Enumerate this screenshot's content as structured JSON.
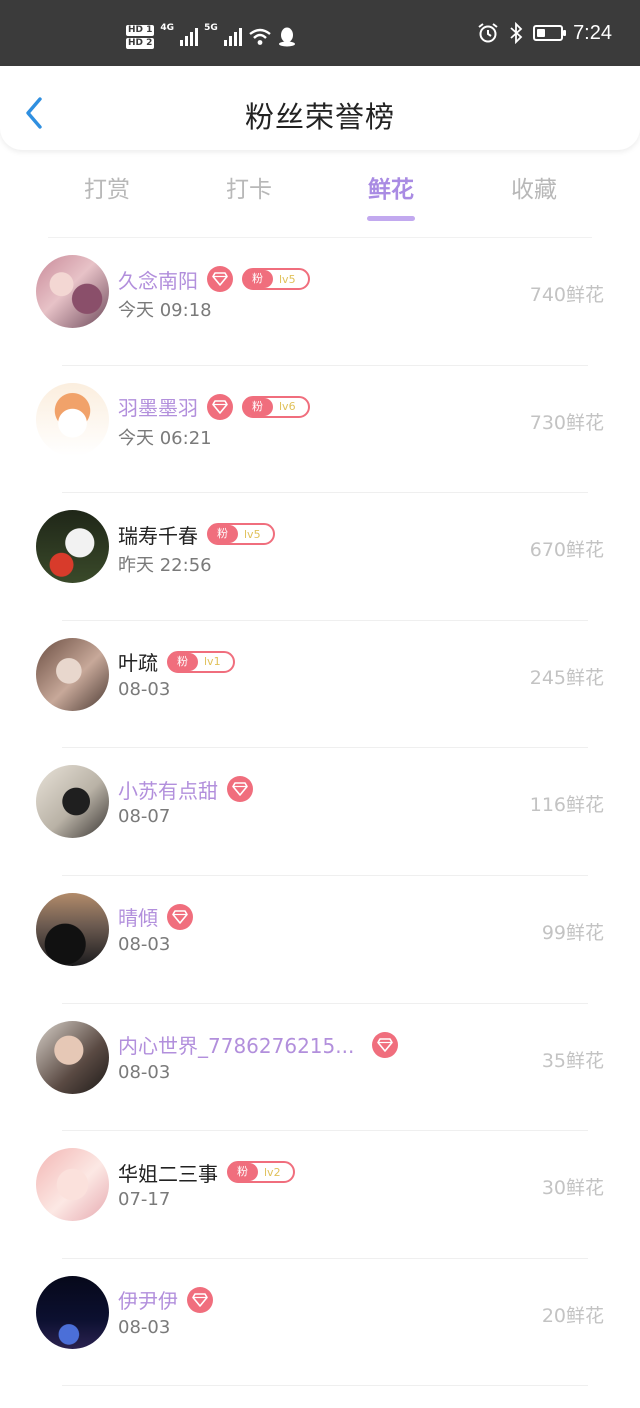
{
  "status_bar": {
    "hd1": "HD 1",
    "hd2": "HD 2",
    "net1": "4G",
    "net2": "5G",
    "time": "7:24",
    "battery_level": 0.35
  },
  "header": {
    "back_icon": "chevron-left-icon",
    "title": "粉丝荣誉榜"
  },
  "tabs": [
    {
      "label": "打赏",
      "active": false
    },
    {
      "label": "打卡",
      "active": false
    },
    {
      "label": "鲜花",
      "active": true
    },
    {
      "label": "收藏",
      "active": false
    }
  ],
  "colors": {
    "accent": "#a98be3",
    "vip_name": "#b28fdc",
    "badge": "#f06e7d"
  },
  "fans": [
    {
      "name": "久念南阳",
      "vip": true,
      "diamond": true,
      "badge_tag": "粉",
      "level": "lv5",
      "time": "今天 09:18",
      "amount": "740鲜花"
    },
    {
      "name": "羽墨墨羽",
      "vip": true,
      "diamond": true,
      "badge_tag": "粉",
      "level": "lv6",
      "time": "今天 06:21",
      "amount": "730鲜花"
    },
    {
      "name": "瑞寿千春",
      "vip": false,
      "diamond": false,
      "badge_tag": "粉",
      "level": "lv5",
      "time": "昨天 22:56",
      "amount": "670鲜花"
    },
    {
      "name": "叶疏",
      "vip": false,
      "diamond": false,
      "badge_tag": "粉",
      "level": "lv1",
      "time": "08-03",
      "amount": "245鲜花"
    },
    {
      "name": "小苏有点甜",
      "vip": true,
      "diamond": true,
      "badge_tag": "",
      "level": "",
      "time": "08-07",
      "amount": "116鲜花"
    },
    {
      "name": "晴傾",
      "vip": true,
      "diamond": true,
      "badge_tag": "",
      "level": "",
      "time": "08-03",
      "amount": "99鲜花"
    },
    {
      "name": "内心世界_7786276215...",
      "vip": true,
      "diamond": true,
      "badge_tag": "",
      "level": "",
      "time": "08-03",
      "amount": "35鲜花"
    },
    {
      "name": "华姐二三事",
      "vip": false,
      "diamond": false,
      "badge_tag": "粉",
      "level": "lv2",
      "time": "07-17",
      "amount": "30鲜花"
    },
    {
      "name": "伊尹伊",
      "vip": true,
      "diamond": true,
      "badge_tag": "",
      "level": "",
      "time": "08-03",
      "amount": "20鲜花"
    }
  ]
}
